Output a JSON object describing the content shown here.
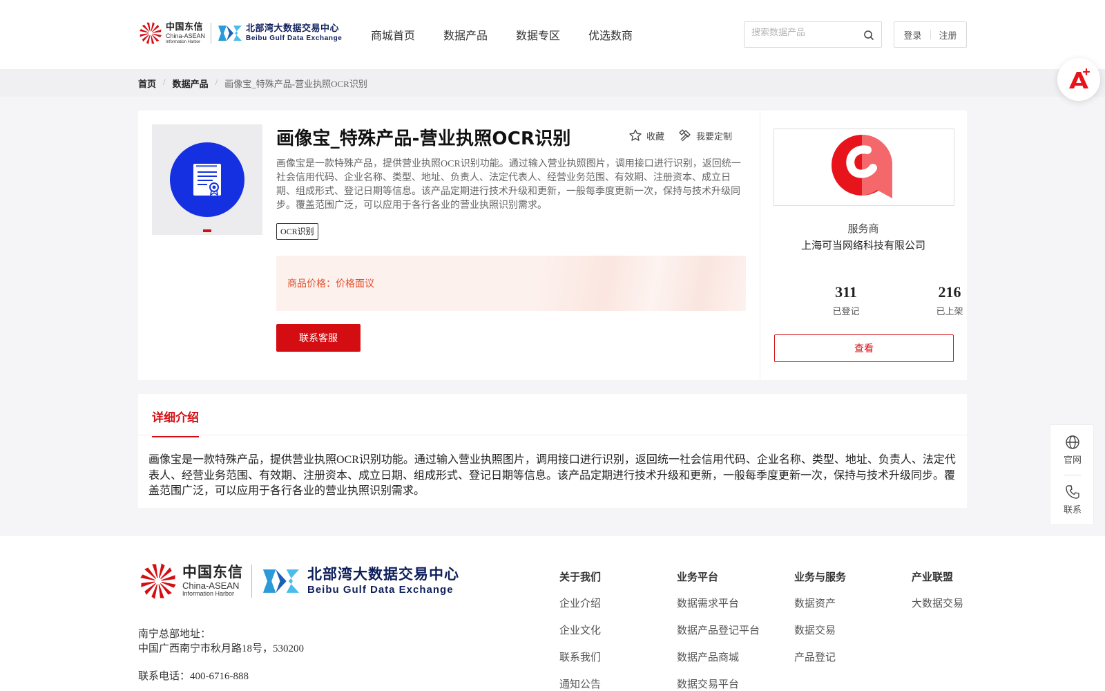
{
  "header": {
    "logo_cdx": {
      "cn": "中国东信",
      "en1": "China-ASEAN",
      "en2": "Information Harbor"
    },
    "logo_bbg": {
      "cn": "北部湾大数据交易中心",
      "en": "Beibu Gulf Data Exchange"
    },
    "nav": [
      "商城首页",
      "数据产品",
      "数据专区",
      "优选数商"
    ],
    "search": {
      "placeholder": "搜索数据产品",
      "value": ""
    },
    "login_label": "登录",
    "register_label": "注册"
  },
  "breadcrumb": {
    "items": [
      "首页",
      "数据产品"
    ],
    "current": "画像宝_特殊产品-营业执照OCR识别"
  },
  "product": {
    "title": "画像宝_特殊产品-营业执照OCR识别",
    "favorite_label": "收藏",
    "customize_label": "我要定制",
    "description": "画像宝是一款特殊产品，提供营业执照OCR识别功能。通过输入营业执照图片，调用接口进行识别，返回统一社会信用代码、企业名称、类型、地址、负责人、法定代表人、经营业务范围、有效期、注册资本、成立日期、组成形式、登记日期等信息。该产品定期进行技术升级和更新，一般每季度更新一次，保持与技术升级同步。覆盖范围广泛，可以应用于各行各业的营业执照识别需求。",
    "tag": "OCR识别",
    "price_label": "商品价格：",
    "price_value": "价格面议",
    "contact_label": "联系客服"
  },
  "vendor": {
    "role_label": "服务商",
    "name": "上海可当网络科技有限公司",
    "registered_count": "311",
    "registered_label": "已登记",
    "listed_count": "216",
    "listed_label": "已上架",
    "view_label": "查看"
  },
  "detail": {
    "tab_label": "详细介绍",
    "text": "画像宝是一款特殊产品，提供营业执照OCR识别功能。通过输入营业执照图片，调用接口进行识别，返回统一社会信用代码、企业名称、类型、地址、负责人、法定代表人、经营业务范围、有效期、注册资本、成立日期、组成形式、登记日期等信息。该产品定期进行技术升级和更新，一般每季度更新一次，保持与技术升级同步。覆盖范围广泛，可以应用于各行各业的营业执照识别需求。"
  },
  "side": {
    "website_label": "官网",
    "contact_label": "联系"
  },
  "footer": {
    "address_label": "南宁总部地址：",
    "address": "中国广西南宁市秋月路18号，530200",
    "phone": "联系电话：400-6716-888",
    "columns": [
      {
        "title": "关于我们",
        "links": [
          "企业介绍",
          "企业文化",
          "联系我们",
          "通知公告"
        ]
      },
      {
        "title": "业务平台",
        "links": [
          "数据需求平台",
          "数据产品登记平台",
          "数据产品商城",
          "数据交易平台"
        ]
      },
      {
        "title": "业务与服务",
        "links": [
          "数据资产",
          "数据交易",
          "产品登记"
        ]
      },
      {
        "title": "产业联盟",
        "links": [
          "大数据交易"
        ]
      }
    ]
  },
  "colors": {
    "brand_red": "#d40d12",
    "price_orange": "#e0522e",
    "thumb_blue": "#1530e0",
    "navy": "#0e1f5b"
  },
  "icons": [
    "pinwheel-logo-icon",
    "bbg-logo-icon",
    "search-icon",
    "star-icon",
    "customize-icon",
    "document-certificate-icon",
    "vendor-q-logo-icon",
    "ai-assistant-icon",
    "globe-icon",
    "phone-icon"
  ]
}
